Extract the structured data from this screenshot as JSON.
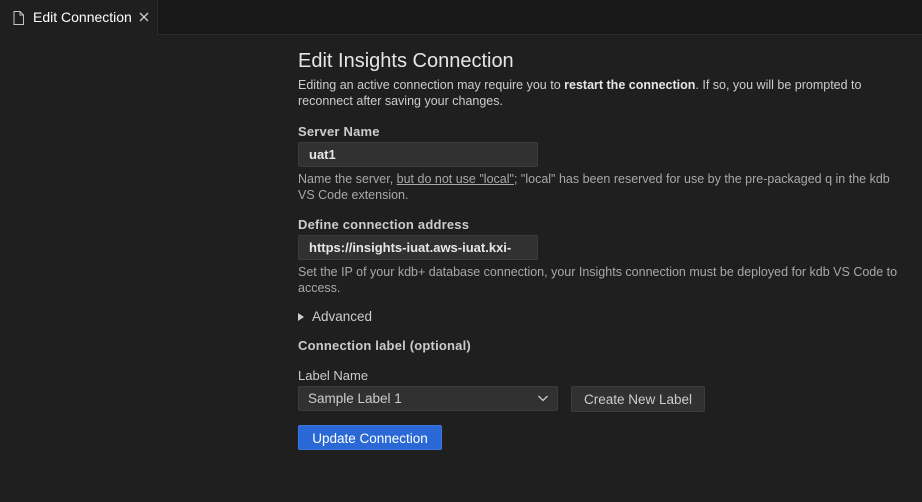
{
  "tab": {
    "label": "Edit Connection",
    "icon": "file-icon",
    "close_icon": "close-icon"
  },
  "form": {
    "title": "Edit Insights Connection",
    "description": {
      "before": "Editing an active connection may require you to ",
      "bold": "restart the connection",
      "after": ". If so, you will be prompted to reconnect after saving your changes."
    },
    "server_name": {
      "label": "Server Name",
      "value": "uat1",
      "help_before": "Name the server, ",
      "help_underlined": "but do not use \"local\"",
      "help_after": "; \"local\" has been reserved for use by the pre-packaged q in the kdb VS Code extension."
    },
    "connection_address": {
      "label": "Define connection address",
      "value": "https://insights-iuat.aws-iuat.kxi-",
      "help": "Set the IP of your kdb+ database connection, your Insights connection must be deployed for kdb VS Code to access."
    },
    "advanced": {
      "label": "Advanced"
    },
    "connection_label": {
      "label": "Connection label (optional)",
      "label_name": "Label Name",
      "selected": "Sample Label 1",
      "create_button": "Create New Label"
    },
    "submit_button": "Update Connection"
  },
  "colors": {
    "background": "#1f1f1f",
    "primary_button": "#2a68d6",
    "input_background": "#313131"
  }
}
